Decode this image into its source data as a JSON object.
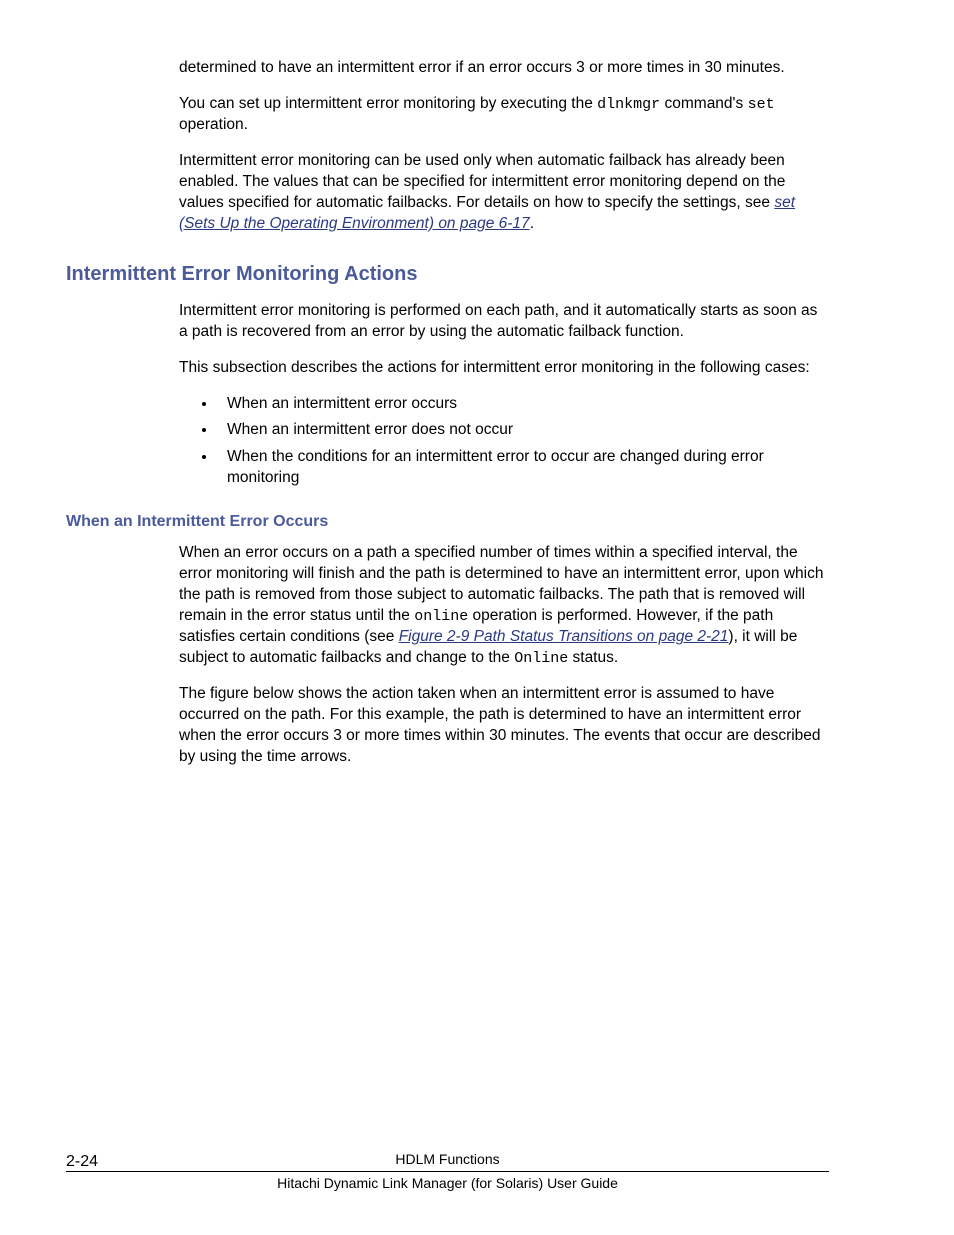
{
  "p1_a": "determined to have an intermittent error if an error occurs 3 or more times in 30 minutes.",
  "p2_a": "You can set up intermittent error monitoring by executing the ",
  "p2_code1": "dlnkmgr",
  "p2_b": " command's ",
  "p2_code2": "set",
  "p2_c": " operation.",
  "p3_a": "Intermittent error monitoring can be used only when automatic failback has already been enabled. The values that can be specified for intermittent error monitoring depend on the values specified for automatic failbacks. For details on how to specify the settings, see ",
  "p3_link": "set (Sets Up the Operating Environment) on page 6-17",
  "p3_b": ".",
  "h1": "Intermittent Error Monitoring Actions",
  "p4": "Intermittent error monitoring is performed on each path, and it automatically starts as soon as a path is recovered from an error by using the automatic failback function.",
  "p5": "This subsection describes the actions for intermittent error monitoring in the following cases:",
  "li1": "When an intermittent error occurs",
  "li2": "When an intermittent error does not occur",
  "li3": "When the conditions for an intermittent error to occur are changed during error monitoring",
  "h2": "When an Intermittent Error Occurs",
  "p6_a": "When an error occurs on a path a specified number of times within a specified interval, the error monitoring will finish and the path is determined to have an intermittent error, upon which the path is removed from those subject to automatic failbacks. The path that is removed will remain in the error status until the ",
  "p6_code1": "online",
  "p6_b": " operation is performed. However, if the path satisfies certain conditions (see ",
  "p6_link": "Figure 2-9 Path Status Transitions on page 2-21",
  "p6_c": "), it will be subject to automatic failbacks and change to the ",
  "p6_code2": "Online",
  "p6_d": " status.",
  "p7": "The figure below shows the action taken when an intermittent error is assumed to have occurred on the path. For this example, the path is determined to have an intermittent error when the error occurs 3 or more times within 30 minutes. The events that occur are described by using the time arrows.",
  "footer_page": "2-24",
  "footer_section": "HDLM Functions",
  "footer_title": "Hitachi Dynamic Link Manager (for Solaris) User Guide"
}
